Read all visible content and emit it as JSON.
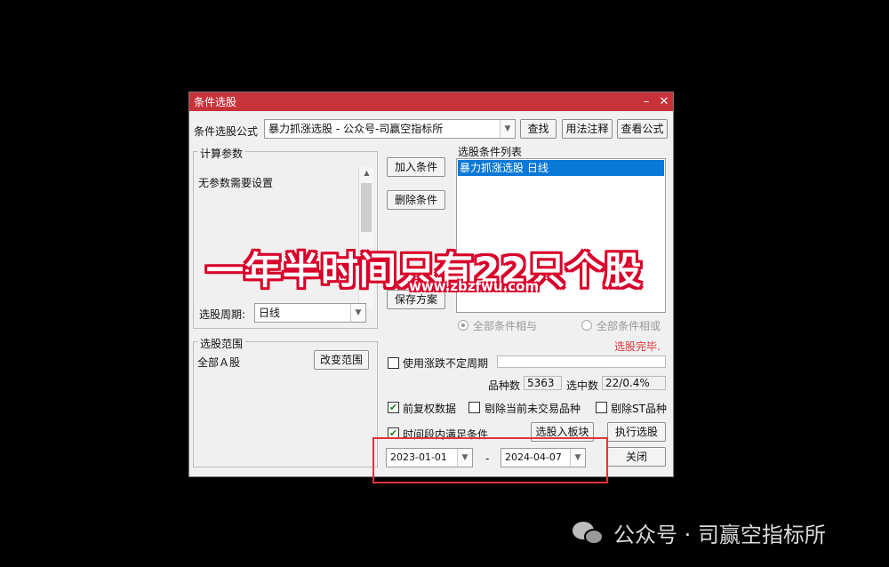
{
  "window": {
    "title": "条件选股",
    "minimize": "–",
    "close": "✕"
  },
  "formula": {
    "label": "条件选股公式",
    "value": "暴力抓涨选股  -  公众号-司赢空指标所",
    "find_btn": "查找",
    "usage_btn": "用法注释",
    "view_btn": "查看公式"
  },
  "params": {
    "group_label": "计算参数",
    "text": "无参数需要设置",
    "period_label": "选股周期:",
    "period_value": "日线"
  },
  "actions": {
    "add": "加入条件",
    "delete": "删除条件",
    "save": "保存方案"
  },
  "conditions": {
    "label": "选股条件列表",
    "items": [
      "暴力抓涨选股  日线"
    ],
    "radio_and": "全部条件相与",
    "radio_or": "全部条件相或",
    "status": "选股完毕."
  },
  "range": {
    "group_label": "选股范围",
    "value": "全部Ａ股",
    "change_btn": "改变范围"
  },
  "options": {
    "use_irregular": "使用涨跌不定周期",
    "count_label": "品种数",
    "count_value": "5363",
    "selected_label": "选中数",
    "selected_value": "22/0.4%",
    "adj_data": "前复权数据",
    "exclude_untraded": "剔除当前未交易品种",
    "exclude_st": "剔除ST品种",
    "time_range": "时间段内满足条件",
    "to_block_btn": "选股入板块",
    "run_btn": "执行选股",
    "close_btn": "关闭",
    "date_from": "2023-01-01",
    "date_sep": "-",
    "date_to": "2024-04-07"
  },
  "overlay": {
    "headline": "一年半时间只有22只个股",
    "url": "www.zbzfwu.com"
  },
  "footer": {
    "text": "公众号 · 司赢空指标所"
  },
  "colors": {
    "titlebar": "#c8323a",
    "selection": "#0a78d7",
    "highlight_box": "#e0353a",
    "status_red": "#e0353a"
  }
}
